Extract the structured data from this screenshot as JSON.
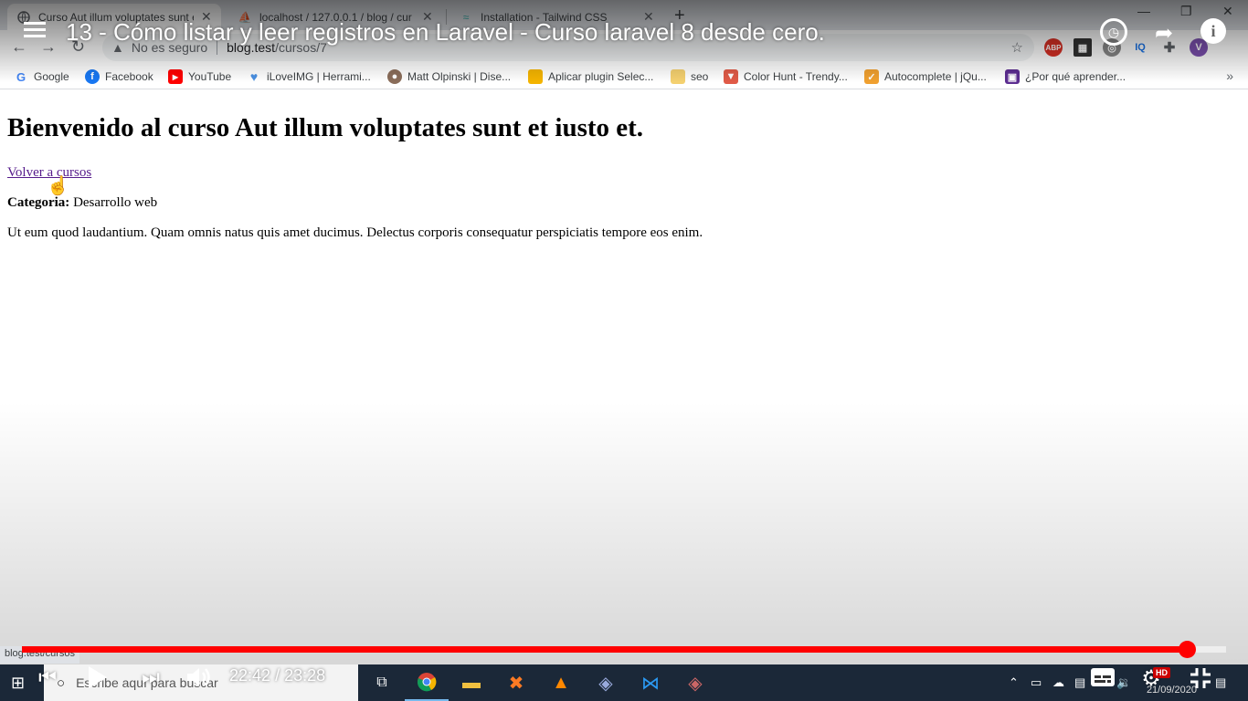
{
  "browser": {
    "tabs": [
      {
        "title": "Curso Aut illum voluptates sunt e",
        "favicon": "globe-icon",
        "active": true
      },
      {
        "title": "localhost / 127.0.0.1 / blog / cur",
        "favicon": "phpmyadmin-icon",
        "active": false
      },
      {
        "title": "Installation - Tailwind CSS",
        "favicon": "tailwind-icon",
        "active": false
      }
    ],
    "omnibox": {
      "security_label": "No es seguro",
      "url_host": "blog.test",
      "url_path": "/cursos/7"
    },
    "bookmarks": [
      {
        "label": "Google",
        "icon": "google-icon",
        "color": "#4285f4"
      },
      {
        "label": "Facebook",
        "icon": "facebook-icon",
        "color": "#1877f2"
      },
      {
        "label": "YouTube",
        "icon": "youtube-icon",
        "color": "#ff0000"
      },
      {
        "label": "iLoveIMG | Herrami...",
        "icon": "heart-icon",
        "color": "#4a90e2"
      },
      {
        "label": "Matt Olpinski | Dise...",
        "icon": "avatar-icon",
        "color": "#8a6d5a"
      },
      {
        "label": "Aplicar plugin Selec...",
        "icon": "folder-icon",
        "color": "#f4b400"
      },
      {
        "label": "seo",
        "icon": "folder-icon",
        "color": "#f4d06f"
      },
      {
        "label": "Color Hunt - Trendy...",
        "icon": "colorhunt-icon",
        "color": "#e05a47"
      },
      {
        "label": "Autocomplete | jQu...",
        "icon": "jquery-icon",
        "color": "#f0a030"
      },
      {
        "label": "¿Por qué aprender...",
        "icon": "grid-icon",
        "color": "#5c2d91"
      }
    ],
    "status_tip": "blog.test/cursos"
  },
  "page": {
    "heading": "Bienvenido al curso Aut illum voluptates sunt et iusto et.",
    "back_link": "Volver a cursos",
    "category_label": "Categoria:",
    "category_value": " Desarrollo web",
    "description": "Ut eum quod laudantium. Quam omnis natus quis amet ducimus. Delectus corporis consequatur perspiciatis tempore eos enim."
  },
  "video": {
    "title": "13 - Cómo listar y leer registros en Laravel - Curso laravel 8 desde cero.",
    "current_time": "22:42",
    "duration": "23:28",
    "time_separator": "/",
    "progress_fraction": 0.9673,
    "hd_badge": "HD",
    "accent_color": "#ff0000"
  },
  "taskbar": {
    "search_placeholder": "Escribe aquí para buscar",
    "date": "21/09/2020"
  }
}
